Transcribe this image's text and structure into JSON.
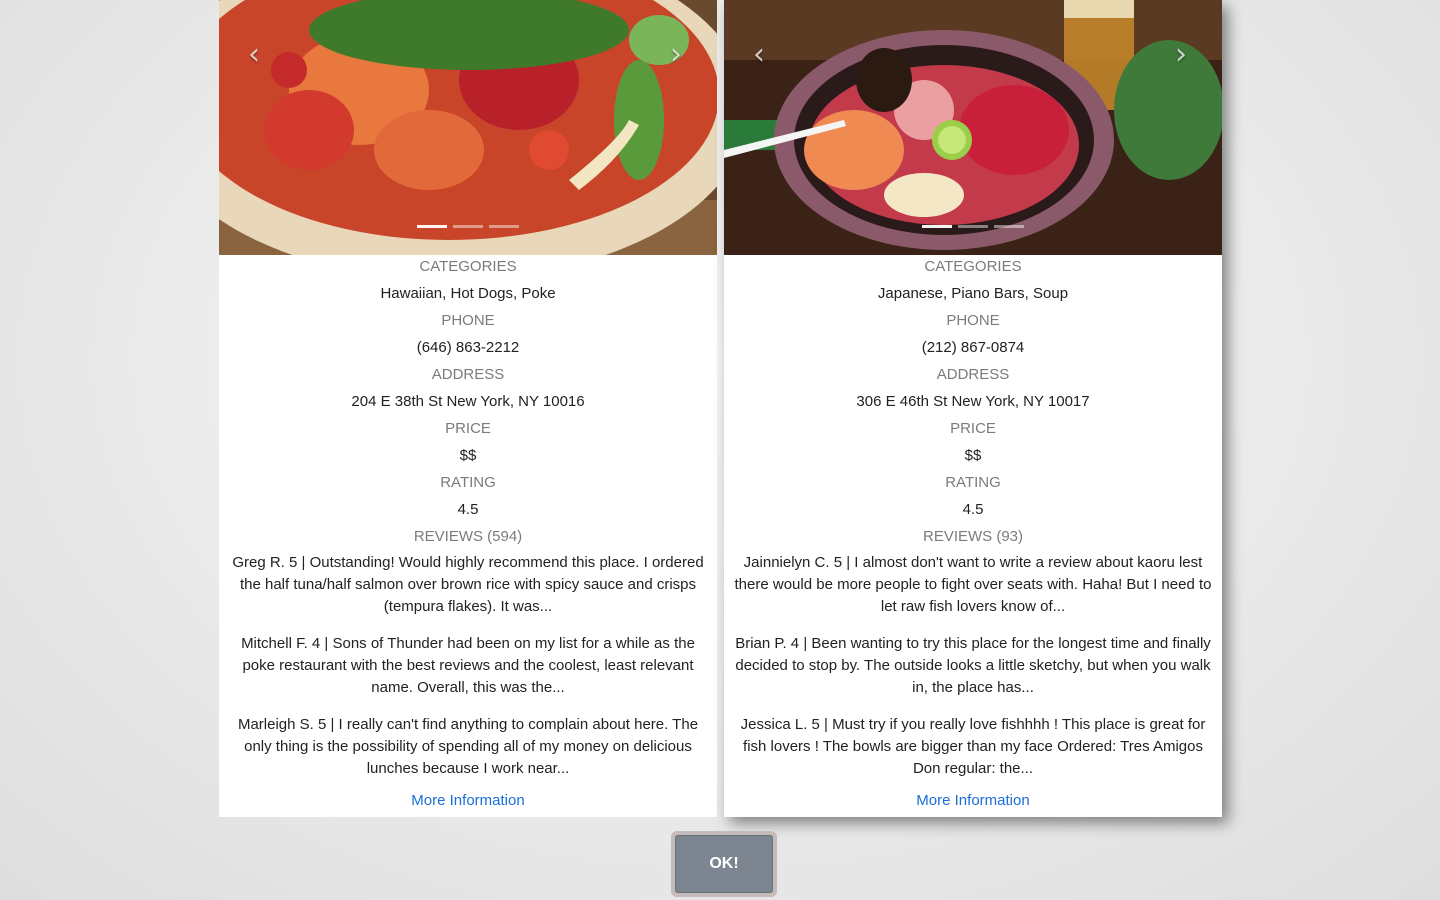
{
  "restaurants": [
    {
      "carousel": {
        "prev_icon": "‹",
        "next_icon": "›",
        "slides": 3,
        "active_slide": 1
      },
      "categories_label": "CATEGORIES",
      "categories": "Hawaiian, Hot Dogs, Poke",
      "phone_label": "PHONE",
      "phone": "(646) 863-2212",
      "address_label": "ADDRESS",
      "address": "204 E 38th St New York, NY 10016",
      "price_label": "PRICE",
      "price": "$$",
      "rating_label": "RATING",
      "rating": "4.5",
      "reviews_label": "REVIEWS (594)",
      "reviews": [
        "Greg R. 5 | Outstanding! Would highly recommend this place. I ordered the half tuna/half salmon over brown rice with spicy sauce and crisps (tempura flakes). It was...",
        "Mitchell F. 4 | Sons of Thunder had been on my list for a while as the poke restaurant with the best reviews and the coolest, least relevant name. Overall, this was the...",
        "Marleigh S. 5 | I really can't find anything to complain about here. The only thing is the possibility of spending all of my money on delicious lunches because I work near..."
      ],
      "more_info": "More Information"
    },
    {
      "carousel": {
        "prev_icon": "‹",
        "next_icon": "›",
        "slides": 3,
        "active_slide": 1
      },
      "categories_label": "CATEGORIES",
      "categories": "Japanese, Piano Bars, Soup",
      "phone_label": "PHONE",
      "phone": "(212) 867-0874",
      "address_label": "ADDRESS",
      "address": "306 E 46th St New York, NY 10017",
      "price_label": "PRICE",
      "price": "$$",
      "rating_label": "RATING",
      "rating": "4.5",
      "reviews_label": "REVIEWS (93)",
      "reviews": [
        "Jainnielyn C. 5 | I almost don't want to write a review about kaoru lest there would be more people to fight over seats with. Haha! But I need to let raw fish lovers know of...",
        "Brian P. 4 | Been wanting to try this place for the longest time and finally decided to stop by. The outside looks a little sketchy, but when you walk in, the place has...",
        "Jessica L. 5 | Must try if you really love fishhhh ! This place is great for fish lovers ! The bowls are bigger than my face Ordered: Tres Amigos Don regular: the..."
      ],
      "more_info": "More Information"
    }
  ],
  "ok_button": "OK!",
  "colors": {
    "label": "#7b7b7b",
    "value": "#222222",
    "link": "#1a6ed8",
    "ok_button_bg": "#7d8690",
    "ok_button_border": "#c6bbbb"
  }
}
